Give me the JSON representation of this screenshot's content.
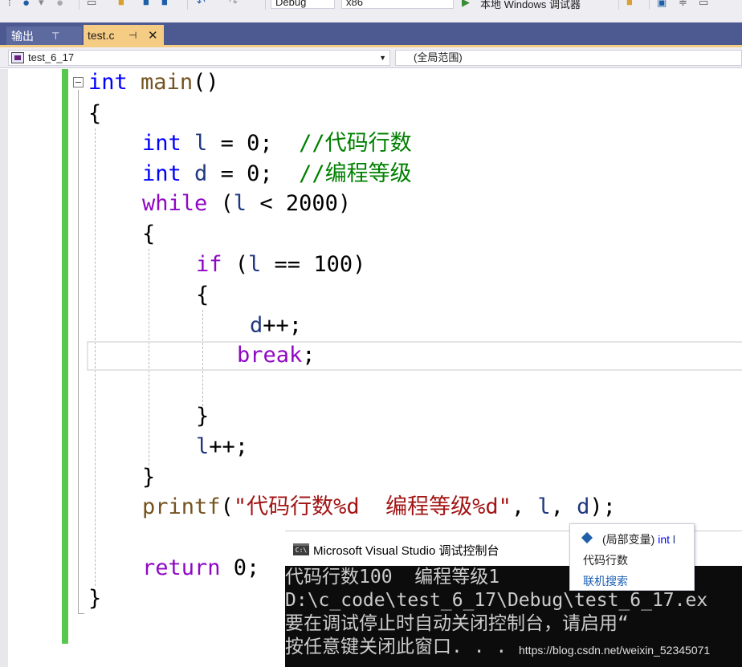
{
  "toolbar": {
    "config": "Debug",
    "platform": "x86",
    "run_label": "本地 Windows 调试器"
  },
  "tabs": [
    {
      "label": "输出",
      "pinned": true,
      "active": false
    },
    {
      "label": "test.c",
      "pinned": true,
      "active": true
    }
  ],
  "navbar": {
    "project": "test_6_17",
    "scope": "(全局范围)"
  },
  "code": {
    "line1": {
      "kw": "int",
      "fn": "main",
      "rest": "()"
    },
    "line2": "{",
    "line3": {
      "kw": "int",
      "var": "l",
      "rest": " = 0;  ",
      "comment": "//代码行数"
    },
    "line4": {
      "kw": "int",
      "var": "d",
      "rest": " = 0;  ",
      "comment": "//编程等级"
    },
    "line5": {
      "kw": "while",
      "open": " (",
      "var": "l",
      "rest": " < 2000)"
    },
    "line6": "{",
    "line7": {
      "kw": "if",
      "open": " (",
      "var": "l",
      "rest": " == 100)"
    },
    "line8": "{",
    "line9": {
      "var": "d",
      "rest": "++;"
    },
    "line10": {
      "kw": "break",
      "rest": ";"
    },
    "line12": "}",
    "line13": {
      "var": "l",
      "rest": "++;"
    },
    "line14": "}",
    "line15": {
      "fn": "printf",
      "open": "(",
      "str": "\"代码行数%d  编程等级%d\"",
      "sep1": ", ",
      "var1": "l",
      "sep2": ", ",
      "var2": "d",
      "rest": ");"
    },
    "line17": {
      "kw": "return",
      "rest": " 0;"
    },
    "line18": "}"
  },
  "console": {
    "title": "Microsoft Visual Studio 调试控制台",
    "icon_text": "C:\\",
    "lines": [
      "代码行数100  编程等级1",
      "D:\\c_code\\test_6_17\\Debug\\test_6_17.ex",
      "要在调试停止时自动关闭控制台，请启用“",
      "按任意键关闭此窗口. . ."
    ]
  },
  "tooltip": {
    "scope": "(局部变量)",
    "type": "int",
    "var": "l",
    "description": "代码行数",
    "search_link": "联机搜索"
  },
  "watermark": "https://blog.csdn.net/weixin_52345071"
}
